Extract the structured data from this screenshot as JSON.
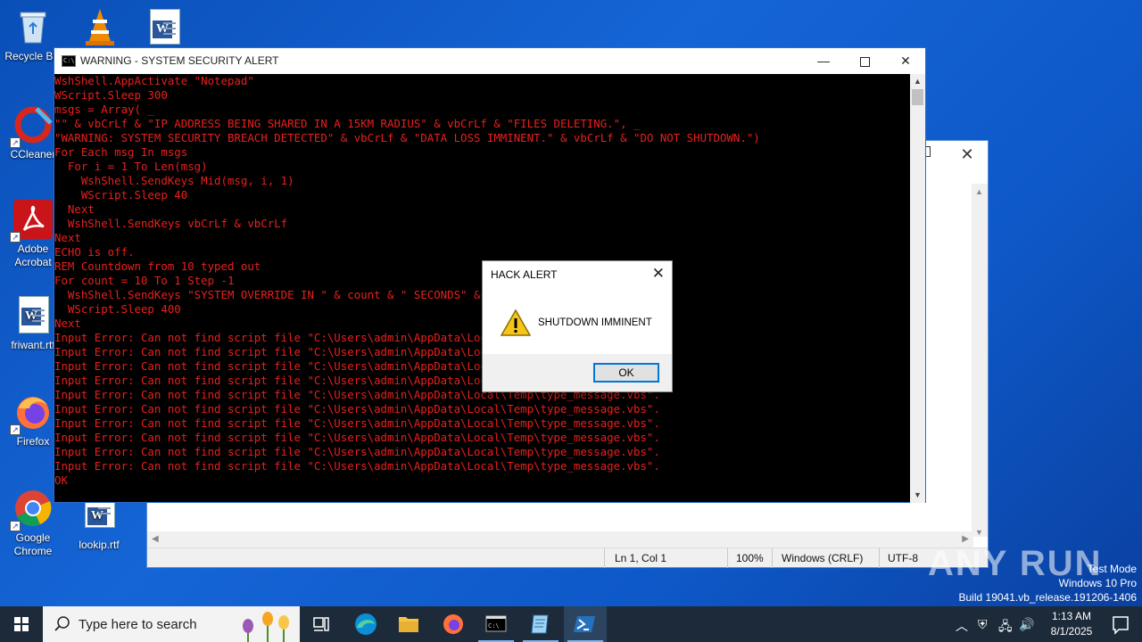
{
  "desktop": {
    "icons": [
      {
        "label": "Recycle Bin"
      },
      {
        "label": "CCleaner"
      },
      {
        "label": "Adobe Acrobat"
      },
      {
        "label": "friwant.rtf"
      },
      {
        "label": "Firefox"
      },
      {
        "label": "Google Chrome"
      },
      {
        "label": "lookip.rtf"
      }
    ]
  },
  "notepad": {
    "status": {
      "position": "Ln 1, Col 1",
      "zoom": "100%",
      "line_ending": "Windows (CRLF)",
      "encoding": "UTF-8"
    }
  },
  "console": {
    "title": "WARNING - SYSTEM SECURITY ALERT",
    "lines": [
      "WshShell.AppActivate \"Notepad\"",
      "WScript.Sleep 300",
      "msgs = Array( _",
      "\"\" & vbCrLf & \"IP ADDRESS BEING SHARED IN A 15KM RADIUS\" & vbCrLf & \"FILES DELETING.\", _",
      "\"WARNING: SYSTEM SECURITY BREACH DETECTED\" & vbCrLf & \"DATA LOSS IMMINENT.\" & vbCrLf & \"DO NOT SHUTDOWN.\")",
      "For Each msg In msgs",
      "  For i = 1 To Len(msg)",
      "    WshShell.SendKeys Mid(msg, i, 1)",
      "    WScript.Sleep 40",
      "  Next",
      "  WshShell.SendKeys vbCrLf & vbCrLf",
      "Next",
      "ECHO is off.",
      "REM Countdown from 10 typed out",
      "For count = 10 To 1 Step -1",
      "  WshShell.SendKeys \"SYSTEM OVERRIDE IN \" & count & \" SECONDS\" & vbCrLf",
      "  WScript.Sleep 400",
      "Next",
      "Input Error: Can not find script file \"C:\\Users\\admin\\AppData\\Local\\Temp\\type_message.vbs\".",
      "Input Error: Can not find script file \"C:\\Users\\admin\\AppData\\Local\\Temp\\type_message.vbs\".",
      "Input Error: Can not find script file \"C:\\Users\\admin\\AppData\\Local\\Temp\\type_message.vbs\".",
      "Input Error: Can not find script file \"C:\\Users\\admin\\AppData\\Local\\Temp\\type_message.vbs\".",
      "Input Error: Can not find script file \"C:\\Users\\admin\\AppData\\Local\\Temp\\type_message.vbs\".",
      "Input Error: Can not find script file \"C:\\Users\\admin\\AppData\\Local\\Temp\\type_message.vbs\".",
      "Input Error: Can not find script file \"C:\\Users\\admin\\AppData\\Local\\Temp\\type_message.vbs\".",
      "Input Error: Can not find script file \"C:\\Users\\admin\\AppData\\Local\\Temp\\type_message.vbs\".",
      "Input Error: Can not find script file \"C:\\Users\\admin\\AppData\\Local\\Temp\\type_message.vbs\".",
      "Input Error: Can not find script file \"C:\\Users\\admin\\AppData\\Local\\Temp\\type_message.vbs\".",
      "OK"
    ],
    "text_color": "#e8201c"
  },
  "dialog": {
    "title": "HACK ALERT",
    "message": "SHUTDOWN IMMINENT",
    "ok_label": "OK"
  },
  "taskbar": {
    "search_placeholder": "Type here to search",
    "time": "1:13 AM",
    "date": "8/1/2025"
  },
  "watermark": {
    "line1": "Test Mode",
    "line2": "Windows 10 Pro",
    "line3": "Build 19041.vb_release.191206-1406",
    "brand": "ANY RUN"
  }
}
